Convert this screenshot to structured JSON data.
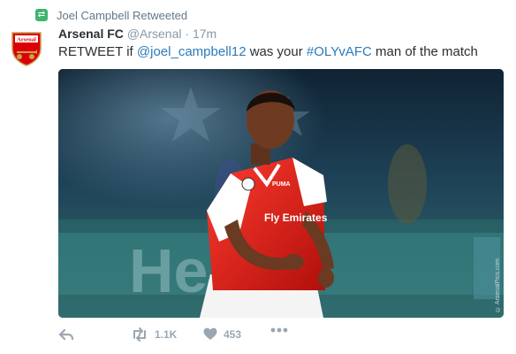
{
  "retweet_context": {
    "text": "Joel Campbell Retweeted"
  },
  "tweet": {
    "author_name": "Arsenal FC",
    "author_handle": "@Arsenal",
    "separator": "·",
    "time": "17m",
    "text_prefix": "RETWEET if ",
    "mention": "@joel_campbell12",
    "text_middle": " was your ",
    "hashtag": "#OLYvAFC",
    "text_suffix": " man of the match",
    "avatar_text": "Arsenal",
    "media_credit": "© ArsenalPics.com",
    "media_shirt_sponsor": "Fly Emirates",
    "media_shirt_brand": "PUMA",
    "media_board_text": "Hei"
  },
  "actions": {
    "retweet_count": "1.1K",
    "like_count": "453"
  },
  "colors": {
    "link": "#2b7bb9",
    "retweet_badge": "#3fb36f",
    "action_icon": "#9aa7b2",
    "arsenal_red": "#db0007"
  }
}
